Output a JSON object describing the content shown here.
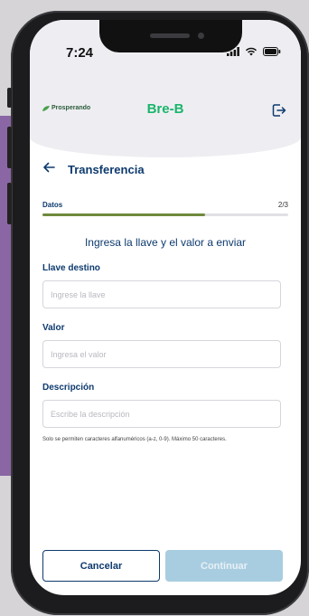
{
  "status_bar": {
    "time": "7:24"
  },
  "header": {
    "brand": "Prosperando",
    "app_title": "Bre-B"
  },
  "nav": {
    "title": "Transferencia"
  },
  "progress": {
    "step_name": "Datos",
    "step_count": "2/3",
    "fraction": 0.66
  },
  "form": {
    "instruction": "Ingresa la llave y el valor a enviar",
    "key_label": "Llave destino",
    "key_placeholder": "Ingrese la llave",
    "key_value": "",
    "amount_label": "Valor",
    "amount_placeholder": "Ingresa el valor",
    "amount_value": "",
    "description_label": "Descripción",
    "description_placeholder": "Escribe la descripción",
    "description_value": "",
    "hint": "Solo se permiten caracteres alfanuméricos (a-z, 0-9). Máximo 50 caracteres."
  },
  "actions": {
    "cancel_label": "Cancelar",
    "continue_label": "Continuar"
  },
  "colors": {
    "brand_green": "#19b56b",
    "navy": "#0d3a6e",
    "progress": "#6f8a3d",
    "continue_disabled": "#a9cde0"
  },
  "icons": {
    "back": "arrow-left-icon",
    "logout": "logout-icon",
    "signal": "signal-icon",
    "wifi": "wifi-icon",
    "battery": "battery-icon"
  }
}
